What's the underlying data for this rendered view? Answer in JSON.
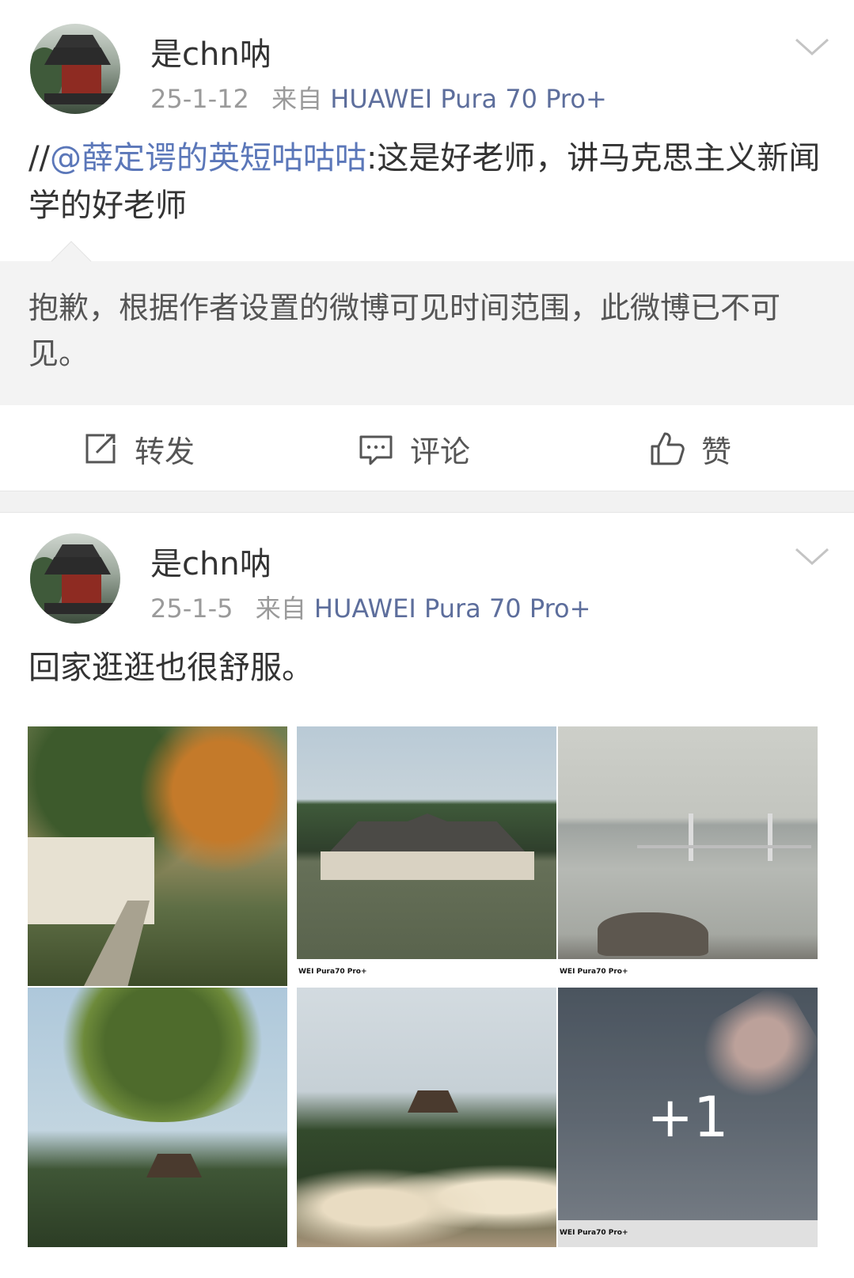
{
  "posts": [
    {
      "username": "是chn呐",
      "date": "25-1-12",
      "from_label": "来自",
      "source": "HUAWEI Pura 70 Pro+",
      "text_prefix": "//",
      "mention": "@薛定谔的英短咕咕咕",
      "text_rest": ":这是好老师，讲马克思主义新闻学的好老师",
      "quoted_notice": "抱歉，根据作者设置的微博可见时间范围，此微博已不可见。",
      "actions": {
        "repost": "转发",
        "comment": "评论",
        "like": "赞"
      }
    },
    {
      "username": "是chn呐",
      "date": "25-1-5",
      "from_label": "来自",
      "source": "HUAWEI Pura 70 Pro+",
      "text": "回家逛逛也很舒服。",
      "photos": [
        {
          "name": "photo-garden-path",
          "caption": ""
        },
        {
          "name": "photo-lakeside-pavilion",
          "caption": "WEI Pura70 Pro+"
        },
        {
          "name": "photo-river-bridge",
          "caption": "WEI Pura70 Pro+"
        },
        {
          "name": "photo-hill-temple-tree",
          "caption": ""
        },
        {
          "name": "photo-hill-temple-reeds",
          "caption": ""
        },
        {
          "name": "photo-sky-cloud",
          "caption": "WEI Pura70 Pro+"
        }
      ],
      "more_photos": "+1"
    }
  ],
  "colors": {
    "link": "#5b77b9",
    "source": "#5d6e9c",
    "meta": "#9a9a9a"
  }
}
